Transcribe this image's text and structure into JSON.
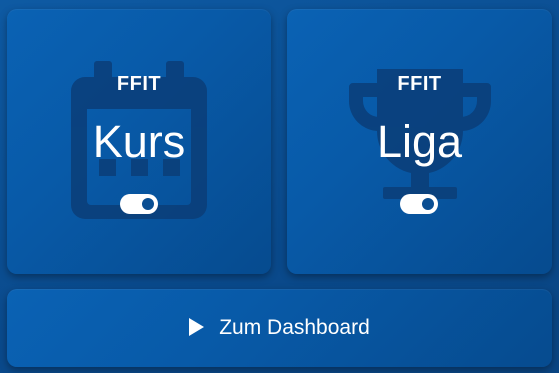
{
  "cards": [
    {
      "brand": "FFIT",
      "title": "Kurs",
      "background_icon": "calendar-icon",
      "toggle_on": true
    },
    {
      "brand": "FFIT",
      "title": "Liga",
      "background_icon": "trophy-icon",
      "toggle_on": true
    }
  ],
  "dashboard_button": {
    "icon": "play-icon",
    "label": "Zum Dashboard"
  },
  "colors": {
    "background": "#0a4a8c",
    "card": "#085aa8",
    "icon_shadow": "#0a3a6e",
    "text": "#ffffff"
  }
}
